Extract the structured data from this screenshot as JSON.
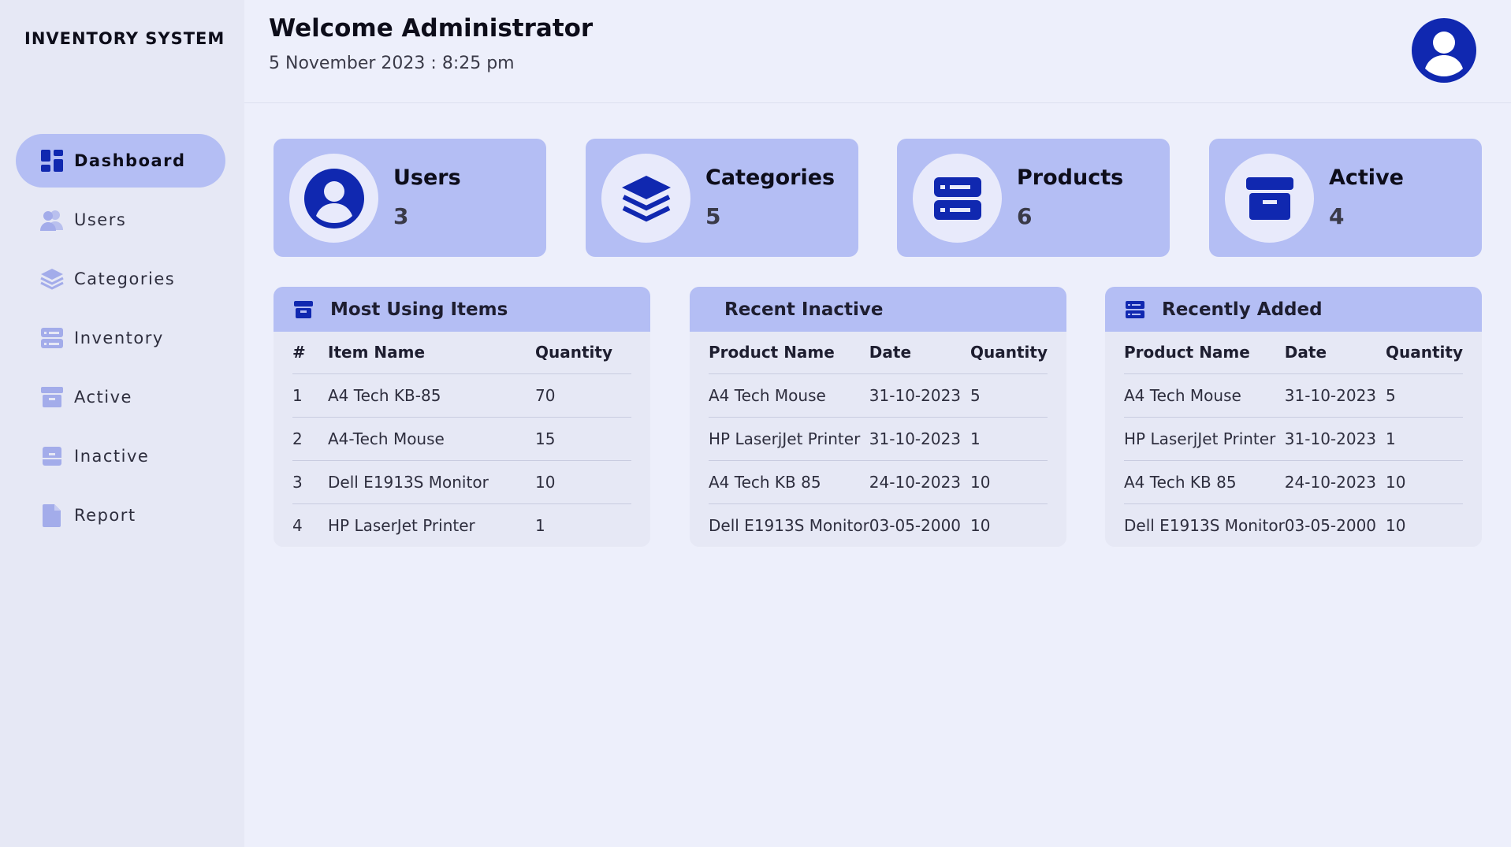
{
  "app": {
    "title": "INVENTORY SYSTEM"
  },
  "sidebar": {
    "items": [
      {
        "label": "Dashboard",
        "icon": "dashboard-icon",
        "active": true
      },
      {
        "label": "Users",
        "icon": "users-icon",
        "active": false
      },
      {
        "label": "Categories",
        "icon": "layers-icon",
        "active": false
      },
      {
        "label": "Inventory",
        "icon": "server-icon",
        "active": false
      },
      {
        "label": "Active",
        "icon": "archive-icon",
        "active": false
      },
      {
        "label": "Inactive",
        "icon": "archive-icon",
        "active": false
      },
      {
        "label": "Report",
        "icon": "document-icon",
        "active": false
      }
    ]
  },
  "header": {
    "welcome": "Welcome Administrator",
    "datetime": "5 November 2023 : 8:25 pm",
    "avatar_icon": "user-avatar-icon"
  },
  "stats": [
    {
      "title": "Users",
      "value": "3",
      "icon": "user-icon"
    },
    {
      "title": "Categories",
      "value": "5",
      "icon": "layers-icon"
    },
    {
      "title": "Products",
      "value": "6",
      "icon": "server-icon"
    },
    {
      "title": "Active",
      "value": "4",
      "icon": "archive-icon"
    }
  ],
  "panels": {
    "most_using": {
      "title": "Most Using Items",
      "icon": "archive-icon",
      "columns": [
        "#",
        "Item Name",
        "Quantity"
      ],
      "rows": [
        [
          "1",
          "A4 Tech KB-85",
          "70"
        ],
        [
          "2",
          "A4-Tech Mouse",
          "15"
        ],
        [
          "3",
          "Dell E1913S Monitor",
          "10"
        ],
        [
          "4",
          "HP LaserJet Printer",
          "1"
        ]
      ]
    },
    "recent_inactive": {
      "title": "Recent Inactive",
      "columns": [
        "Product Name",
        "Date",
        "Quantity"
      ],
      "rows": [
        [
          "A4 Tech Mouse",
          "31-10-2023",
          "5"
        ],
        [
          "HP LaserjJet Printer",
          "31-10-2023",
          "1"
        ],
        [
          "A4 Tech KB 85",
          "24-10-2023",
          "10"
        ],
        [
          "Dell E1913S Monitor",
          "03-05-2000",
          "10"
        ]
      ]
    },
    "recently_added": {
      "title": "Recently Added",
      "icon": "server-icon",
      "columns": [
        "Product Name",
        "Date",
        "Quantity"
      ],
      "rows": [
        [
          "A4 Tech Mouse",
          "31-10-2023",
          "5"
        ],
        [
          "HP LaserjJet Printer",
          "31-10-2023",
          "1"
        ],
        [
          "A4 Tech KB 85",
          "24-10-2023",
          "10"
        ],
        [
          "Dell E1913S Monitor",
          "03-05-2000",
          "10"
        ]
      ]
    }
  },
  "colors": {
    "accent": "#1028b0",
    "card": "#b4bef4",
    "background": "#edeffb",
    "sidebar": "#e6e8f5"
  }
}
